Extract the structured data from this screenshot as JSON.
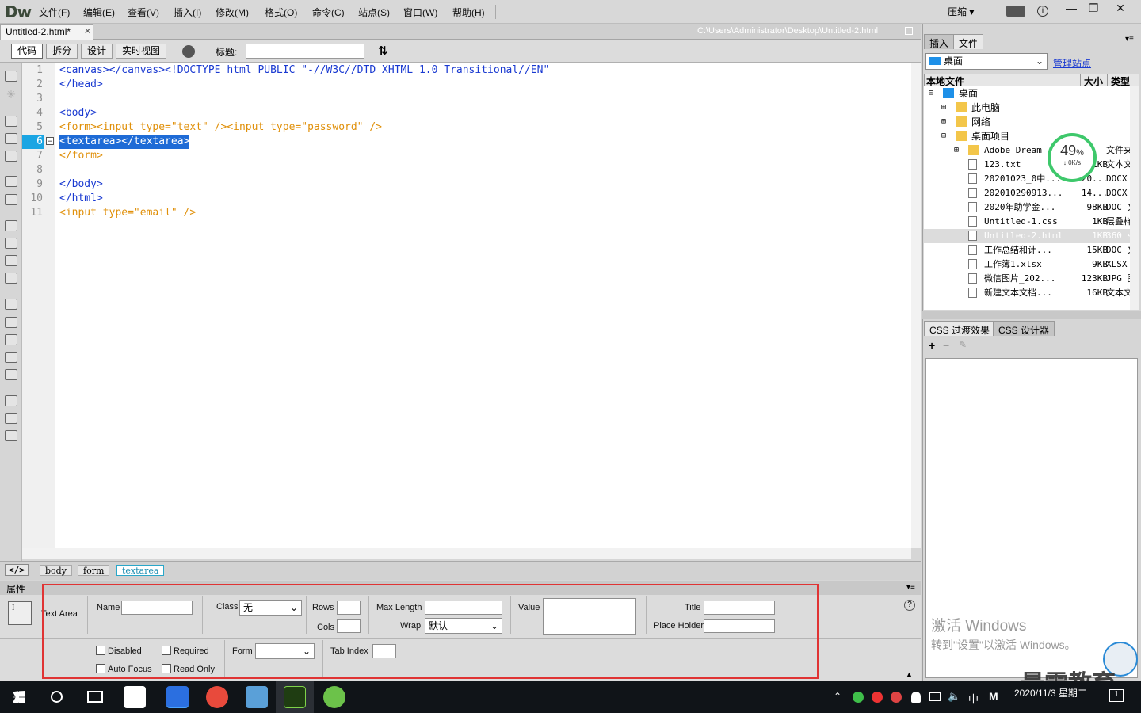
{
  "app": {
    "logo": "Dw",
    "menus": [
      "文件(F)",
      "编辑(E)",
      "查看(V)",
      "插入(I)",
      "修改(M)",
      "格式(O)",
      "命令(C)",
      "站点(S)",
      "窗口(W)",
      "帮助(H)"
    ],
    "layout_menu": "压缩 ▾",
    "win_controls": [
      "—",
      "❐",
      "✕"
    ]
  },
  "document": {
    "tab": "Untitled-2.html*",
    "close": "✕",
    "path": "C:\\Users\\Administrator\\Desktop\\Untitled-2.html"
  },
  "toolbar": {
    "views": [
      "代码",
      "拆分",
      "设计",
      "实时视图"
    ],
    "title_label": "标题:",
    "title_value": ""
  },
  "code": {
    "line_numbers": [
      "1",
      "2",
      "3",
      "4",
      "5",
      "6",
      "7",
      "8",
      "9",
      "10",
      "11"
    ],
    "lines": [
      "<canvas></canvas><!DOCTYPE html PUBLIC \"-//W3C//DTD XHTML 1.0 Transitional//EN\"",
      "</head>",
      "",
      "<body>",
      "<form><input type=\"text\" /><input type=\"password\" />",
      "<textarea></textarea>",
      "</form>",
      "",
      "</body>",
      "</html>",
      "<input type=\"email\" />"
    ]
  },
  "tagbar": {
    "tags": [
      "body",
      "form",
      "textarea"
    ]
  },
  "properties": {
    "title": "属性",
    "element": "Text Area",
    "name_label": "Name",
    "class_label": "Class",
    "class_value": "无",
    "rows_label": "Rows",
    "cols_label": "Cols",
    "maxlen_label": "Max Length",
    "wrap_label": "Wrap",
    "wrap_value": "默认",
    "value_label": "Value",
    "title_label": "Title",
    "placeholder_label": "Place Holder",
    "disabled": "Disabled",
    "required": "Required",
    "autofocus": "Auto Focus",
    "readonly": "Read Only",
    "form_label": "Form",
    "tabindex_label": "Tab Index",
    "help": "?"
  },
  "files_panel": {
    "tabs": [
      "插入",
      "文件"
    ],
    "location": "桌面",
    "manage": "管理站点",
    "header": {
      "name": "本地文件",
      "size": "大小",
      "type": "类型"
    },
    "rows": [
      {
        "name": "桌面",
        "size": "",
        "type": "",
        "level": 0,
        "expander": "⊟"
      },
      {
        "name": "此电脑",
        "size": "",
        "type": "",
        "level": 1,
        "expander": "⊞"
      },
      {
        "name": "网络",
        "size": "",
        "type": "",
        "level": 1,
        "expander": "⊞"
      },
      {
        "name": "桌面项目",
        "size": "",
        "type": "",
        "level": 1,
        "expander": "⊟"
      },
      {
        "name": "Adobe Dream",
        "size": "",
        "type": "文件夹",
        "level": 2,
        "expander": "⊞"
      },
      {
        "name": "123.txt",
        "size": "1KB",
        "type": "文本文档",
        "level": 2,
        "expander": ""
      },
      {
        "name": "20201023_0中...",
        "size": "20...",
        "type": "DOCX 文档",
        "level": 2,
        "expander": ""
      },
      {
        "name": "20201029091З...",
        "size": "14...",
        "type": "DOCX 文档",
        "level": 2,
        "expander": ""
      },
      {
        "name": "2020年助学金...",
        "size": "98KB",
        "type": "DOC 文档",
        "level": 2,
        "expander": ""
      },
      {
        "name": "Untitled-1.css",
        "size": "1KB",
        "type": "层叠样式",
        "level": 2,
        "expander": ""
      },
      {
        "name": "Untitled-2.html",
        "size": "1KB",
        "type": "360 se",
        "level": 2,
        "expander": ""
      },
      {
        "name": "工作总结和计...",
        "size": "15KB",
        "type": "DOC 文档",
        "level": 2,
        "expander": ""
      },
      {
        "name": "工作簿1.xlsx",
        "size": "9KB",
        "type": "XLSX ...",
        "level": 2,
        "expander": ""
      },
      {
        "name": "微信图片_202...",
        "size": "123KB",
        "type": "JPG 图片",
        "level": 2,
        "expander": ""
      },
      {
        "name": "新建文本文档...",
        "size": "16KB",
        "type": "文本文档",
        "level": 2,
        "expander": ""
      }
    ]
  },
  "net_badge": {
    "percent": "49",
    "unit": "%",
    "rate": "↓ 0K/s"
  },
  "css_panel": {
    "tabs": [
      "CSS 过渡效果",
      "CSS 设计器"
    ],
    "add": "+",
    "remove": "−",
    "edit": "✎"
  },
  "watermark": {
    "line1": "激活 Windows",
    "line2": "转到\"设置\"以激活 Windows。"
  },
  "brand": "最需教育",
  "taskbar": {
    "clock_time": "",
    "clock_date": "2020/11/3 星期二",
    "ime": "中",
    "ime2": "M",
    "notif": "1"
  },
  "colors": {
    "selected_line": "#1aa5e3",
    "highlight_box": "#e03434",
    "code_tag": "#1a3ad1",
    "code_form_tag": "#e0900a"
  }
}
